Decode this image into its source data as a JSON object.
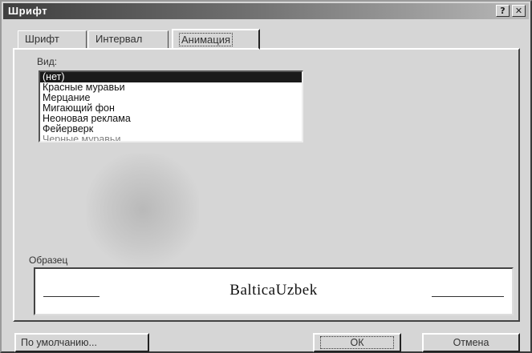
{
  "window": {
    "title": "Шрифт",
    "help_button": "?",
    "close_button": "✕"
  },
  "tabs": [
    {
      "label": "Шрифт",
      "active": false
    },
    {
      "label": "Интервал",
      "active": false
    },
    {
      "label": "Анимация",
      "active": true
    }
  ],
  "animation": {
    "vid_label": "Вид:",
    "items": [
      {
        "label": "(нет)",
        "selected": true
      },
      {
        "label": "Красные муравьи",
        "selected": false
      },
      {
        "label": "Мерцание",
        "selected": false
      },
      {
        "label": "Мигающий фон",
        "selected": false
      },
      {
        "label": "Неоновая реклама",
        "selected": false
      },
      {
        "label": "Фейерверк",
        "selected": false
      },
      {
        "label": "Черные муравьи",
        "selected": false
      }
    ]
  },
  "sample": {
    "label": "Образец",
    "text": "BalticaUzbek"
  },
  "buttons": {
    "default_label": "По умолчанию...",
    "ok_label": "ОК",
    "cancel_label": "Отмена"
  }
}
